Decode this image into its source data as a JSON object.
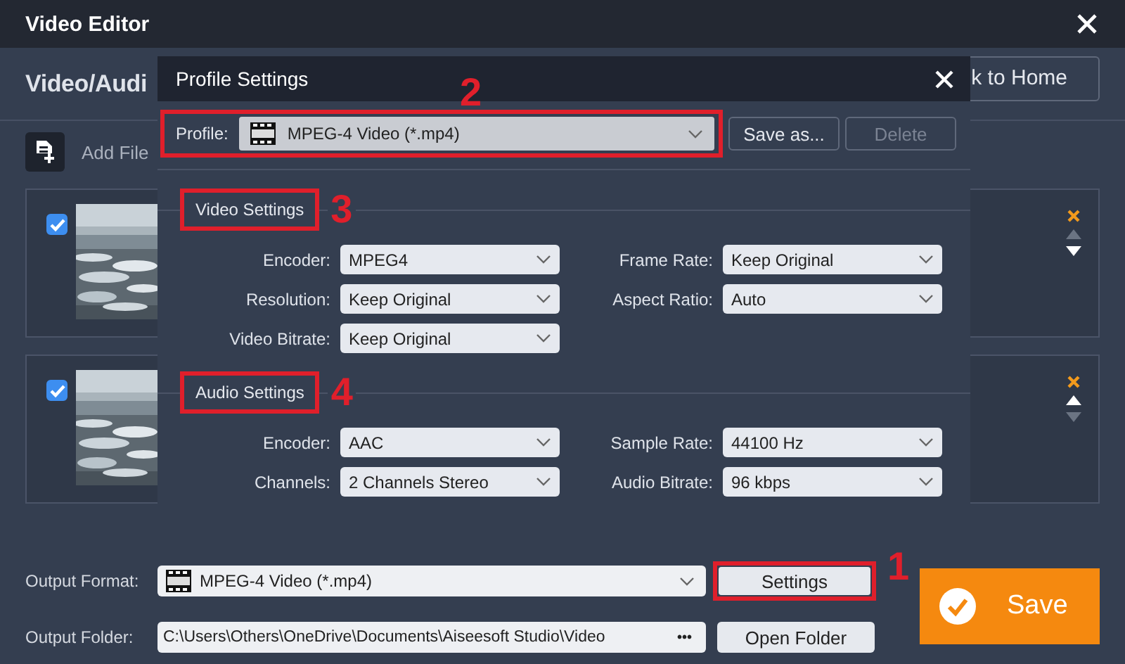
{
  "window": {
    "title": "Video Editor"
  },
  "header": {
    "title": "Video/Audi",
    "back_button": "k to Home"
  },
  "toolbar": {
    "add_file": "Add File"
  },
  "files": [
    {
      "checked": true,
      "can_move_up": false,
      "can_move_down": true
    },
    {
      "checked": true,
      "can_move_up": true,
      "can_move_down": false
    }
  ],
  "output": {
    "format_label": "Output Format:",
    "format": "MPEG-4 Video (*.mp4)",
    "settings_button": "Settings",
    "settings_annotation": "1",
    "folder_label": "Output Folder:",
    "folder": "C:\\Users\\Others\\OneDrive\\Documents\\Aiseesoft Studio\\Video",
    "browse": "•••",
    "open_folder": "Open Folder",
    "save": "Save"
  },
  "dialog": {
    "title": "Profile Settings",
    "profile_label": "Profile:",
    "profile": "MPEG-4 Video (*.mp4)",
    "profile_annotation": "2",
    "save_as": "Save as...",
    "delete": {
      "label": "Delete",
      "disabled": true
    },
    "sections": [
      {
        "title": "Video Settings",
        "annotation": "3",
        "rows": [
          [
            {
              "label": "Encoder:",
              "value": "MPEG4"
            },
            {
              "label": "Frame Rate:",
              "value": "Keep Original"
            }
          ],
          [
            {
              "label": "Resolution:",
              "value": "Keep Original"
            },
            {
              "label": "Aspect Ratio:",
              "value": "Auto"
            }
          ],
          [
            {
              "label": "Video Bitrate:",
              "value": "Keep Original"
            }
          ]
        ]
      },
      {
        "title": "Audio Settings",
        "annotation": "4",
        "rows": [
          [
            {
              "label": "Encoder:",
              "value": "AAC"
            },
            {
              "label": "Sample Rate:",
              "value": "44100 Hz"
            }
          ],
          [
            {
              "label": "Channels:",
              "value": "2 Channels Stereo"
            },
            {
              "label": "Audio Bitrate:",
              "value": "96 kbps"
            }
          ]
        ]
      }
    ]
  }
}
